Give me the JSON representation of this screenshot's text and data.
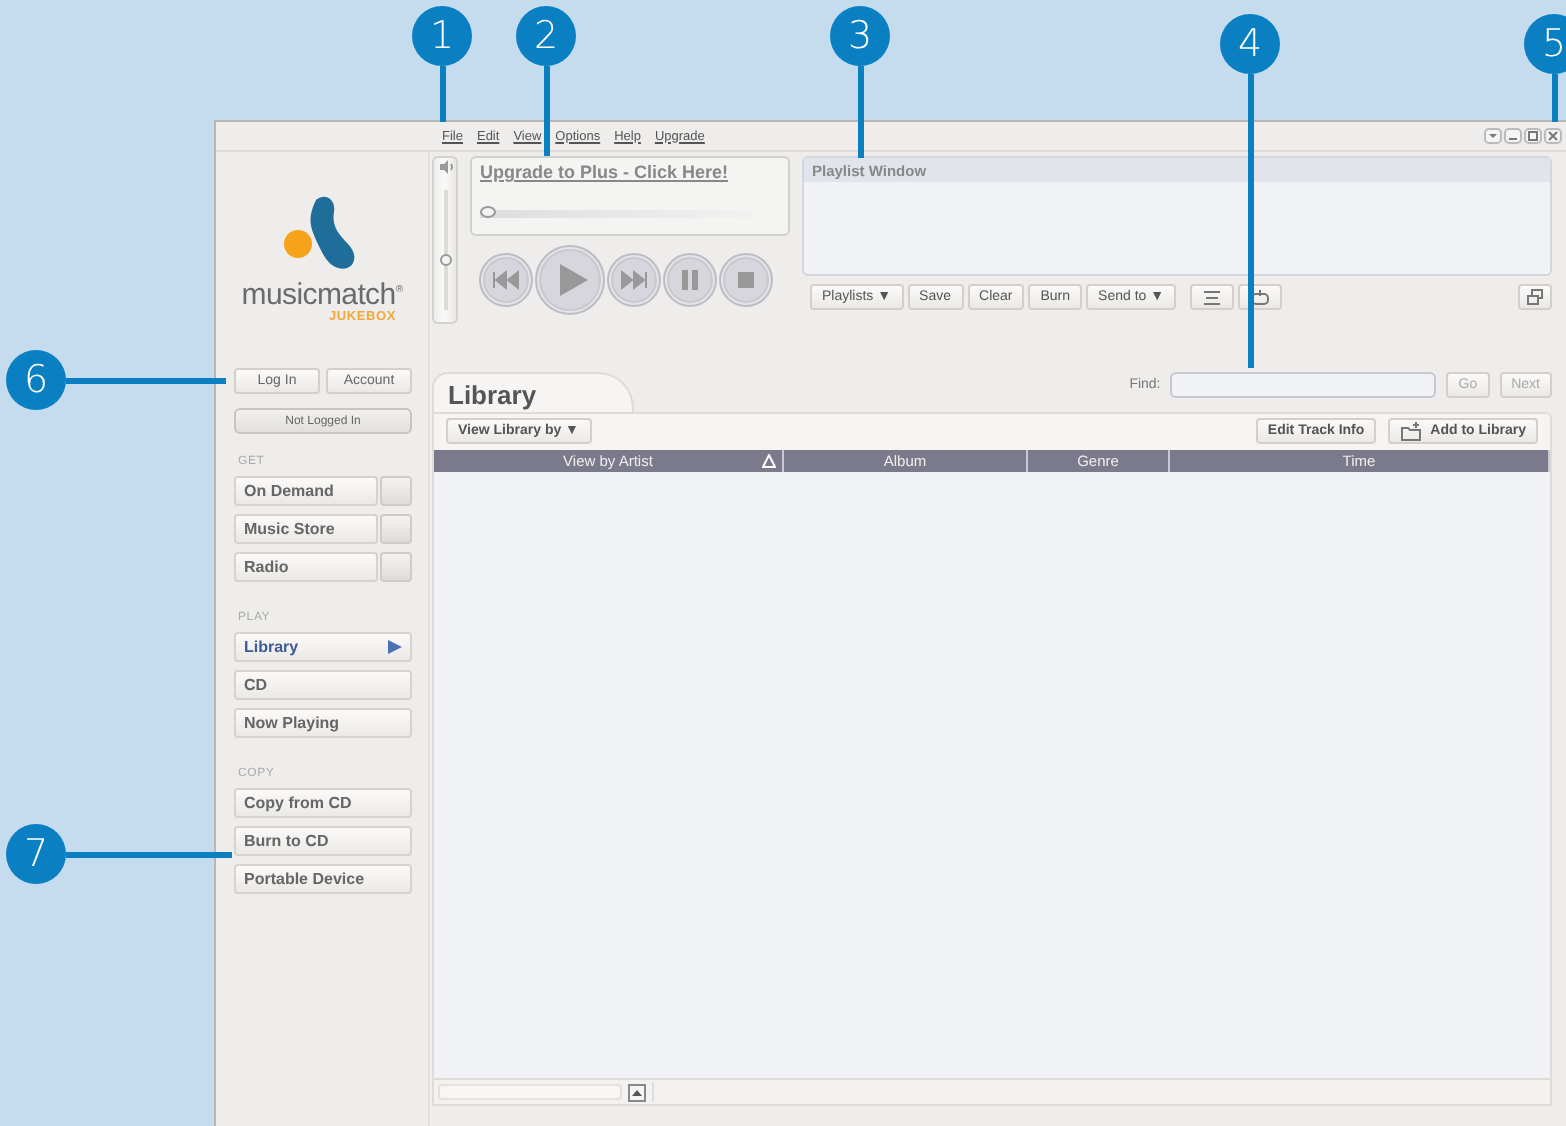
{
  "menu": [
    "File",
    "Edit",
    "View",
    "Options",
    "Help",
    "Upgrade"
  ],
  "logo": {
    "name": "musicmatch",
    "mark": "®",
    "product": "JUKEBOX"
  },
  "player": {
    "volume": {
      "level": 0.4
    },
    "upgrade_link": "Upgrade to Plus - Click Here!",
    "seek": {
      "level": 0
    }
  },
  "playlist": {
    "title": "Playlist Window",
    "buttons": [
      "Playlists ▼",
      "Save",
      "Clear",
      "Burn",
      "Send to ▼"
    ]
  },
  "account": {
    "buttons": [
      "Log In",
      "Account"
    ],
    "status": "Not Logged In"
  },
  "sidebar": [
    {
      "heading": "GET",
      "items": [
        {
          "label": "On Demand",
          "kind": "split",
          "selected": false
        },
        {
          "label": "Music Store",
          "kind": "split",
          "selected": false
        },
        {
          "label": "Radio",
          "kind": "split",
          "selected": false
        }
      ]
    },
    {
      "heading": "PLAY",
      "items": [
        {
          "label": "Library",
          "kind": "plain",
          "selected": true
        },
        {
          "label": "CD",
          "kind": "plain",
          "selected": false
        },
        {
          "label": "Now Playing",
          "kind": "plain",
          "selected": false
        }
      ]
    },
    {
      "heading": "COPY",
      "items": [
        {
          "label": "Copy from CD",
          "kind": "plain",
          "selected": false
        },
        {
          "label": "Burn to CD",
          "kind": "plain",
          "selected": false
        },
        {
          "label": "Portable Device",
          "kind": "plain",
          "selected": false
        }
      ]
    }
  ],
  "library": {
    "tab": "Library",
    "find_label": "Find:",
    "find_buttons": [
      {
        "label": "Go",
        "disabled": true
      },
      {
        "label": "Next",
        "disabled": true
      }
    ],
    "view_button": "View Library by ▼",
    "actions": [
      "Edit Track Info",
      "Add to Library"
    ],
    "columns": [
      {
        "label": "View by Artist",
        "sorted": true
      },
      {
        "label": "Album",
        "sorted": false
      },
      {
        "label": "Genre",
        "sorted": false
      },
      {
        "label": "Time",
        "sorted": false
      }
    ]
  },
  "callouts": [
    "1",
    "2",
    "3",
    "4",
    "5",
    "6",
    "7"
  ]
}
